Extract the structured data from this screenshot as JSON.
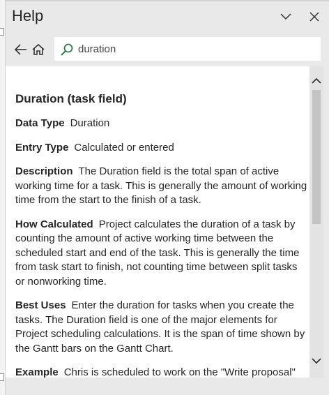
{
  "header": {
    "title": "Help"
  },
  "search": {
    "value": "duration"
  },
  "article": {
    "title": "Duration (task field)",
    "sections": [
      {
        "label": "Data Type",
        "text": "Duration"
      },
      {
        "label": "Entry Type",
        "text": "Calculated or entered"
      },
      {
        "label": "Description",
        "text": "The Duration field is the total span of active working time for a task. This is generally the amount of working time from the start to the finish of a task."
      },
      {
        "label": "How Calculated",
        "text": "Project calculates the duration of a task by counting the amount of active working time between the scheduled start and end of the task. This is generally the time from task start to finish, not counting time between split tasks or nonworking time."
      },
      {
        "label": "Best Uses",
        "text": "Enter the duration for tasks when you create the tasks. The Duration field is one of the major elements for Project scheduling calculations. It is the span of time shown by the Gantt bars on the Gantt Chart."
      },
      {
        "label": "Example",
        "text": "Chris is scheduled to work on the \"Write proposal\""
      }
    ]
  },
  "colors": {
    "accent": "#2e7d4f",
    "panel_bg": "#e9e9e9",
    "content_bg": "#ffffff"
  },
  "icons": [
    "chevron-down-icon",
    "close-icon",
    "back-arrow-icon",
    "home-icon",
    "search-icon",
    "scroll-up-icon",
    "scroll-down-icon"
  ]
}
